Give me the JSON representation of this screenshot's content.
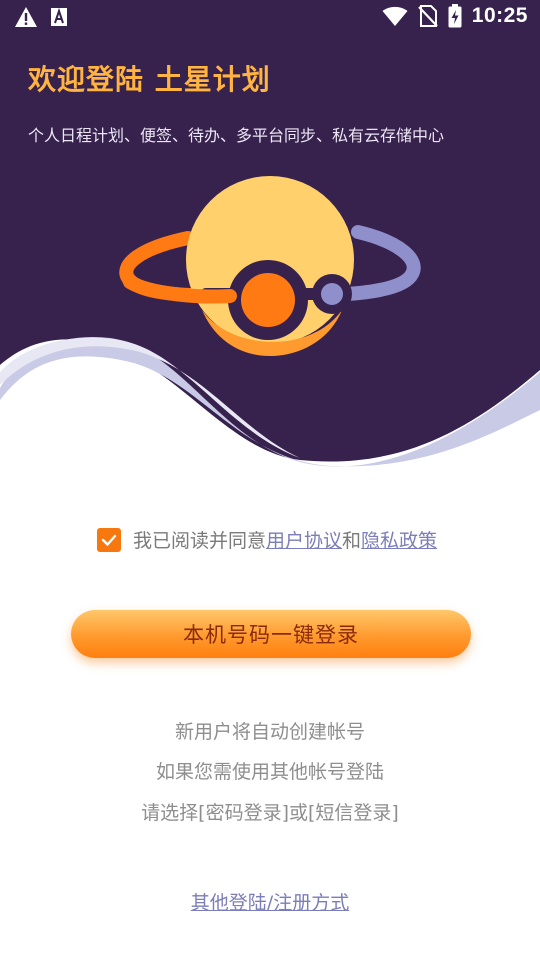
{
  "status_bar": {
    "time": "10:25",
    "left_icons": [
      "warning-icon",
      "text-icon"
    ],
    "right_icons": [
      "wifi-icon",
      "no-sim-icon",
      "battery-charging-icon"
    ]
  },
  "header": {
    "title": "欢迎登陆  土星计划",
    "subtitle": "个人日程计划、便签、待办、多平台同步、私有云存储中心"
  },
  "agreement": {
    "checked": true,
    "text_prefix": "我已阅读并同意",
    "user_agreement_link": "用户协议",
    "text_and": "和",
    "privacy_link": "隐私政策"
  },
  "login_button": {
    "label": "本机号码一键登录"
  },
  "info": {
    "line1": "新用户将自动创建帐号",
    "line2": "如果您需使用其他帐号登陆",
    "line3": "请选择[密码登录]或[短信登录]"
  },
  "other_login": {
    "label": "其他登陆/注册方式"
  },
  "colors": {
    "header_bg": "#37214D",
    "wave_light": "#C9CAE6",
    "accent_orange": "#F6780F",
    "title_orange": "#FFB340",
    "planet_yellow": "#FFD06B",
    "ring_orange": "#FF7A12",
    "ring_purple": "#8E8FCB",
    "link_color": "#7B7EB8"
  }
}
